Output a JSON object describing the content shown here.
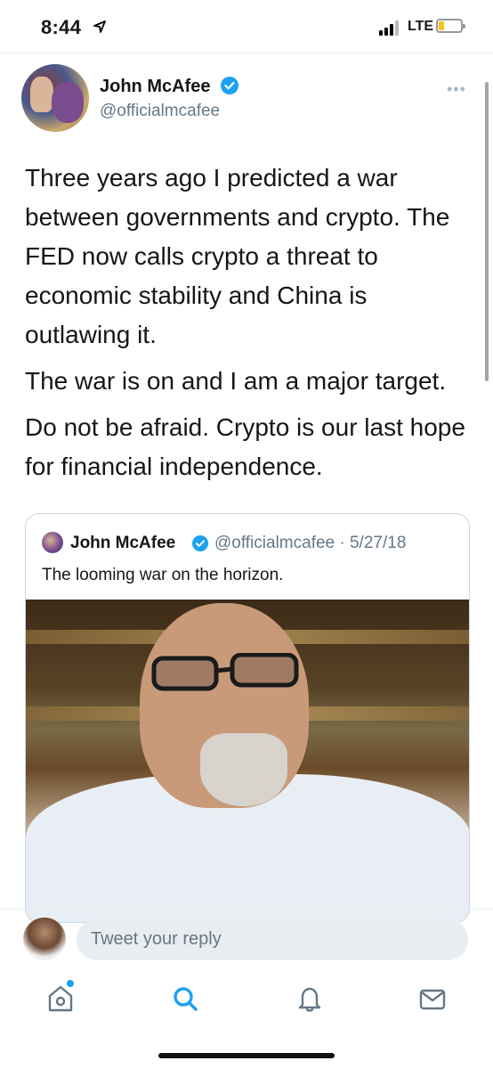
{
  "status_bar": {
    "time": "8:44",
    "network": "LTE",
    "battery_level": 0.25
  },
  "tweet": {
    "display_name": "John McAfee",
    "handle": "@officialmcafee",
    "verified": true,
    "more_icon": "more-dots-icon",
    "paragraphs": [
      "Three years ago I predicted a war between governments and crypto. The FED now calls crypto a threat to economic stability and China is outlawing it.",
      "The war is on and I am a major target.",
      "Do not be afraid. Crypto is our last hope for financial independence."
    ]
  },
  "quoted_tweet": {
    "display_name": "John McAfee",
    "handle_date": "@officialmcafee · 5/27/18",
    "text": "The looming war on the horizon."
  },
  "reply": {
    "placeholder": "Tweet your reply"
  },
  "tab_bar": {
    "items": [
      "home-icon",
      "search-icon",
      "notifications-icon",
      "messages-icon"
    ]
  },
  "colors": {
    "accent": "#1da1f2",
    "secondary_text": "#657786",
    "battery": "#f5c518"
  }
}
